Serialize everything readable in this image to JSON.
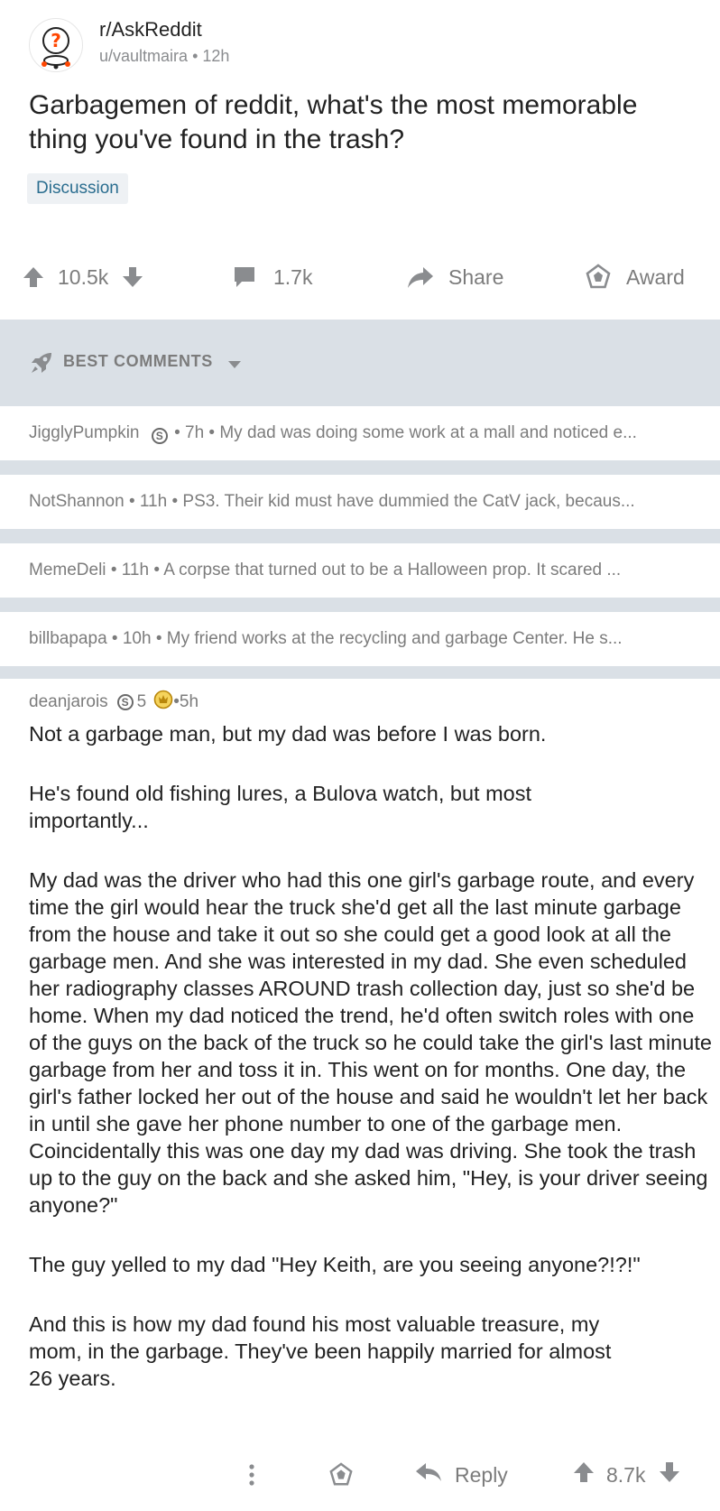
{
  "post": {
    "subreddit": "r/AskReddit",
    "author": "u/vaultmaira",
    "age": "12h",
    "title": "Garbagemen of reddit, what's the most memorable thing you've found in the trash?",
    "flair": "Discussion",
    "upvotes": "10.5k",
    "comments": "1.7k",
    "share_label": "Share",
    "award_label": "Award"
  },
  "best_comments": {
    "label": "BEST COMMENTS",
    "collapsed": [
      {
        "user": "JigglyPumpkin",
        "has_badge": true,
        "age": "7h",
        "preview": "My dad was doing some work at a mall and noticed e..."
      },
      {
        "user": "NotShannon",
        "has_badge": false,
        "age": "11h",
        "preview": "PS3. Their kid must have dummied the CatV jack, becaus..."
      },
      {
        "user": "MemeDeli",
        "has_badge": false,
        "age": "11h",
        "preview": "A corpse that turned out to be a Halloween prop. It scared ..."
      },
      {
        "user": "billbapapa",
        "has_badge": false,
        "age": "10h",
        "preview": "My friend works at the recycling and garbage Center. He s..."
      }
    ]
  },
  "comment": {
    "user": "deanjarois",
    "badge_count": "5",
    "age": "5h",
    "paragraphs": [
      "Not a garbage man, but my dad was before I was born.",
      "He's found old fishing lures, a Bulova watch, but most importantly...",
      "My dad was the driver who had this one girl's garbage route, and every time the girl would hear the truck she'd get all the last minute garbage from the house and take it out so she could get a good look at all the garbage men. And she was interested in my dad. She even scheduled her radiography classes AROUND trash collection day, just so she'd be home. When my dad noticed the trend, he'd often switch roles with one of the guys on the back of the truck so he could take the girl's last minute garbage from her and toss it in. This went on for months. One day, the girl's father locked her out of the house and said he wouldn't let her back in until she gave her phone number to one of the garbage men. Coincidentally this was one day my dad was driving. She took the trash up to the guy on the back and she asked him, \"Hey, is your driver seeing anyone?\"",
      "The guy yelled to my dad \"Hey Keith, are you seeing anyone?!?!\"",
      "And this is how my dad found his most valuable treasure, my mom, in the garbage. They've been happily married for almost 26 years."
    ],
    "reply_label": "Reply",
    "score": "8.7k"
  },
  "colors": {
    "separator": "#dae0e6",
    "meta_gray": "#7c7c7c",
    "flair_text": "#2a6d8f",
    "badge_gold": "#e8b71c"
  }
}
